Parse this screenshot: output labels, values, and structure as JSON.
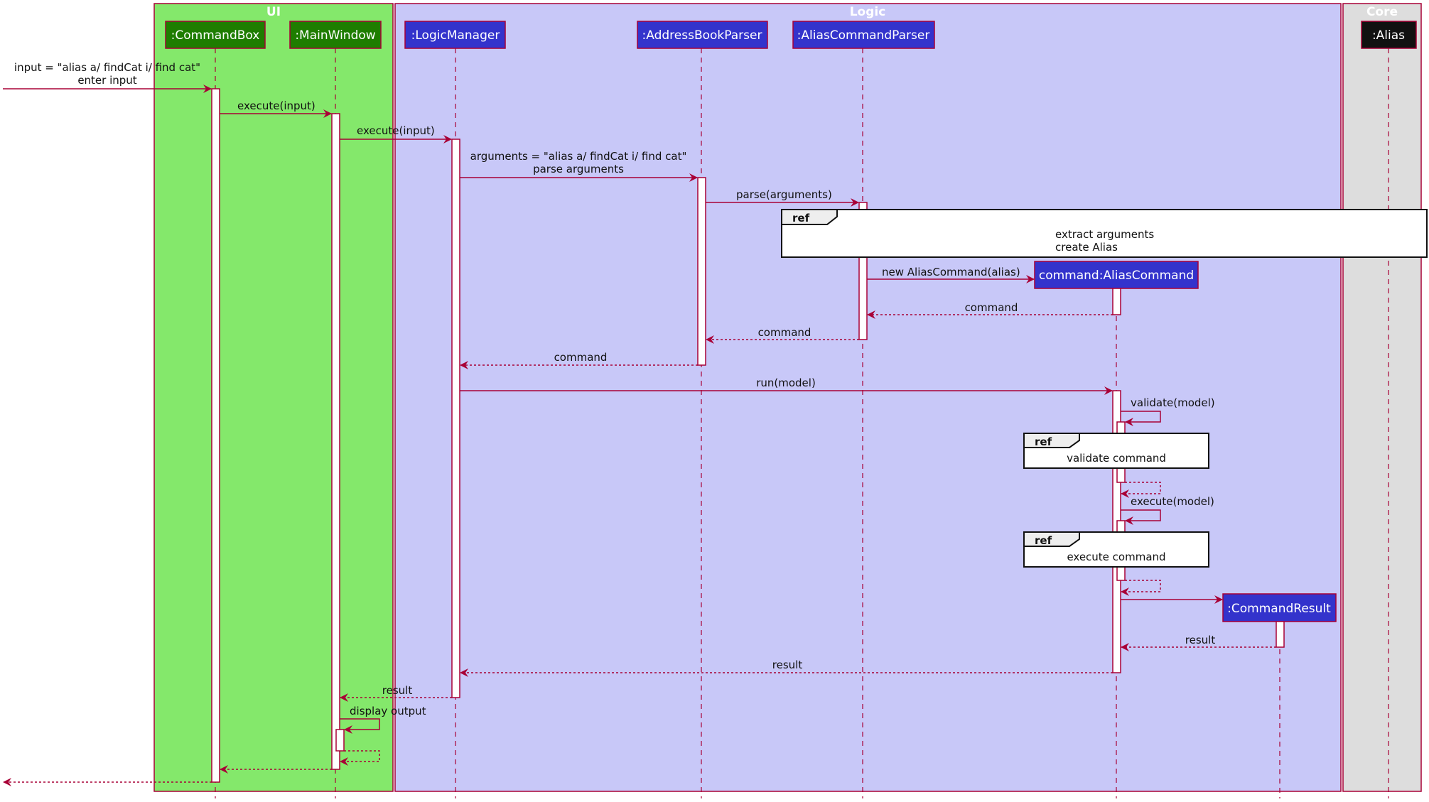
{
  "colors": {
    "line": "#A80036",
    "ui_group_bg": "#84E86B",
    "logic_group_bg": "#C8C8F8",
    "core_group_bg": "#DDDDDD",
    "ui_participant": "#1E7D00",
    "logic_participant": "#3333CC",
    "core_participant": "#111111",
    "ref_bg": "#FFFFFF",
    "ref_tag_bg": "#EEEEEE",
    "activation_bg": "#FFFFFF"
  },
  "groups": [
    {
      "id": "ui",
      "title": "UI"
    },
    {
      "id": "logic",
      "title": "Logic"
    },
    {
      "id": "core",
      "title": "Core"
    }
  ],
  "participants": [
    {
      "id": "commandbox",
      "label": ":CommandBox",
      "group": "ui"
    },
    {
      "id": "mainwindow",
      "label": ":MainWindow",
      "group": "ui"
    },
    {
      "id": "logicmanager",
      "label": ":LogicManager",
      "group": "logic"
    },
    {
      "id": "addressbookparser",
      "label": ":AddressBookParser",
      "group": "logic"
    },
    {
      "id": "aliascommandparser",
      "label": ":AliasCommandParser",
      "group": "logic"
    },
    {
      "id": "aliascommand",
      "label": "command:AliasCommand",
      "group": "logic",
      "created": true
    },
    {
      "id": "commandresult",
      "label": ":CommandResult",
      "group": "logic",
      "created": true
    },
    {
      "id": "alias",
      "label": ":Alias",
      "group": "core"
    }
  ],
  "messages": [
    {
      "from": "external",
      "to": "commandbox",
      "type": "sync",
      "label": [
        "input = \"alias a/ findCat i/ find cat\"",
        "enter input"
      ]
    },
    {
      "from": "commandbox",
      "to": "mainwindow",
      "type": "sync",
      "label": [
        "execute(input)"
      ]
    },
    {
      "from": "mainwindow",
      "to": "logicmanager",
      "type": "sync",
      "label": [
        "execute(input)"
      ]
    },
    {
      "from": "logicmanager",
      "to": "addressbookparser",
      "type": "sync",
      "label": [
        "arguments = \"alias a/ findCat i/ find cat\"",
        "parse arguments"
      ]
    },
    {
      "from": "addressbookparser",
      "to": "aliascommandparser",
      "type": "sync",
      "label": [
        "parse(arguments)"
      ]
    },
    {
      "from": "aliascommandparser",
      "to": "aliascommand",
      "type": "create",
      "label": [
        "new AliasCommand(alias)"
      ]
    },
    {
      "from": "aliascommand",
      "to": "aliascommandparser",
      "type": "return",
      "label": [
        "command"
      ]
    },
    {
      "from": "aliascommandparser",
      "to": "addressbookparser",
      "type": "return",
      "label": [
        "command"
      ]
    },
    {
      "from": "addressbookparser",
      "to": "logicmanager",
      "type": "return",
      "label": [
        "command"
      ]
    },
    {
      "from": "logicmanager",
      "to": "aliascommand",
      "type": "sync",
      "label": [
        "run(model)"
      ]
    },
    {
      "from": "aliascommand",
      "to": "aliascommand",
      "type": "self",
      "label": [
        "validate(model)"
      ]
    },
    {
      "from": "aliascommand",
      "to": "aliascommand",
      "type": "self-return",
      "label": []
    },
    {
      "from": "aliascommand",
      "to": "aliascommand",
      "type": "self",
      "label": [
        "execute(model)"
      ]
    },
    {
      "from": "aliascommand",
      "to": "aliascommand",
      "type": "self-return",
      "label": []
    },
    {
      "from": "aliascommand",
      "to": "commandresult",
      "type": "create",
      "label": []
    },
    {
      "from": "commandresult",
      "to": "aliascommand",
      "type": "return",
      "label": [
        "result"
      ]
    },
    {
      "from": "aliascommand",
      "to": "logicmanager",
      "type": "return",
      "label": [
        "result"
      ]
    },
    {
      "from": "logicmanager",
      "to": "mainwindow",
      "type": "return",
      "label": [
        "result"
      ]
    },
    {
      "from": "mainwindow",
      "to": "mainwindow",
      "type": "self",
      "label": [
        "display output"
      ]
    },
    {
      "from": "mainwindow",
      "to": "mainwindow",
      "type": "self-return",
      "label": []
    },
    {
      "from": "mainwindow",
      "to": "commandbox",
      "type": "return",
      "label": []
    },
    {
      "from": "commandbox",
      "to": "external",
      "type": "return",
      "label": []
    }
  ],
  "refs": [
    {
      "tag": "ref",
      "lines": [
        "extract arguments",
        "create Alias"
      ]
    },
    {
      "tag": "ref",
      "lines": [
        "validate command"
      ]
    },
    {
      "tag": "ref",
      "lines": [
        "execute command"
      ]
    }
  ]
}
